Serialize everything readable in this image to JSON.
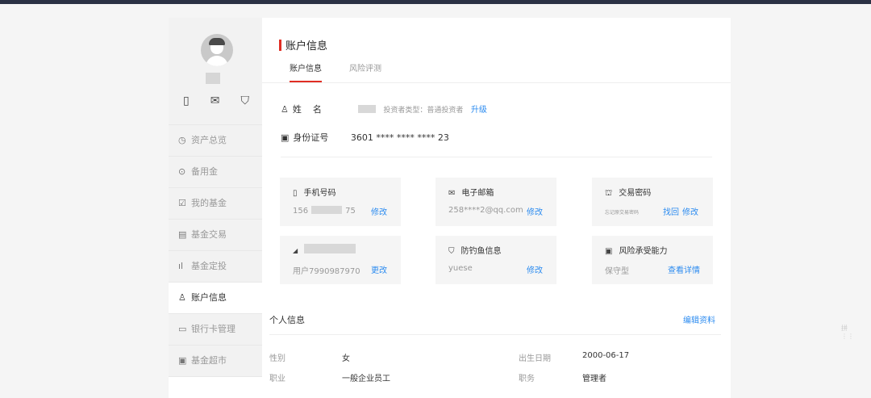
{
  "sidebar": {
    "icons": [
      "mobile-icon",
      "mail-icon",
      "shield-icon"
    ],
    "menu": [
      {
        "icon": "◷",
        "label": "资产总览"
      },
      {
        "icon": "⊙",
        "label": "备用金"
      },
      {
        "icon": "☑",
        "label": "我的基金"
      },
      {
        "icon": "▤",
        "label": "基金交易"
      },
      {
        "icon": "ıl",
        "label": "基金定投"
      },
      {
        "icon": "♙",
        "label": "账户信息"
      },
      {
        "icon": "▭",
        "label": "银行卡管理"
      },
      {
        "icon": "▣",
        "label": "基金超市"
      }
    ]
  },
  "main": {
    "title": "账户信息",
    "tabs": [
      "账户信息",
      "风险评测"
    ],
    "name_label": "姓    名",
    "investor_type": "投资者类型：普通投资者",
    "upgrade": "升级",
    "id_label": "身份证号",
    "id_value": "3601 **** **** **** 23",
    "cards": {
      "phone": {
        "title": "手机号码",
        "value_start": "156",
        "value_end": "75",
        "action": "修改"
      },
      "email": {
        "title": "电子邮箱",
        "value": "258****2@qq.com",
        "action": "修改"
      },
      "password": {
        "title": "交易密码",
        "value": "忘记原交易密码",
        "action1": "找回",
        "action2": "修改"
      },
      "username": {
        "value": "用户7990987970",
        "action": "更改"
      },
      "phishing": {
        "title": "防钓鱼信息",
        "value": "yuese",
        "action": "修改"
      },
      "risk": {
        "title": "风险承受能力",
        "value": "保守型",
        "action": "查看详情"
      }
    },
    "personal": {
      "title": "个人信息",
      "edit": "编辑资料",
      "gender_label": "性别",
      "gender": "女",
      "birth_label": "出生日期",
      "birth": "2000-06-17",
      "job_label": "职业",
      "job": "一般企业员工",
      "position_label": "职务",
      "position": "管理者"
    }
  },
  "corner": "拼 ⋮⋮"
}
